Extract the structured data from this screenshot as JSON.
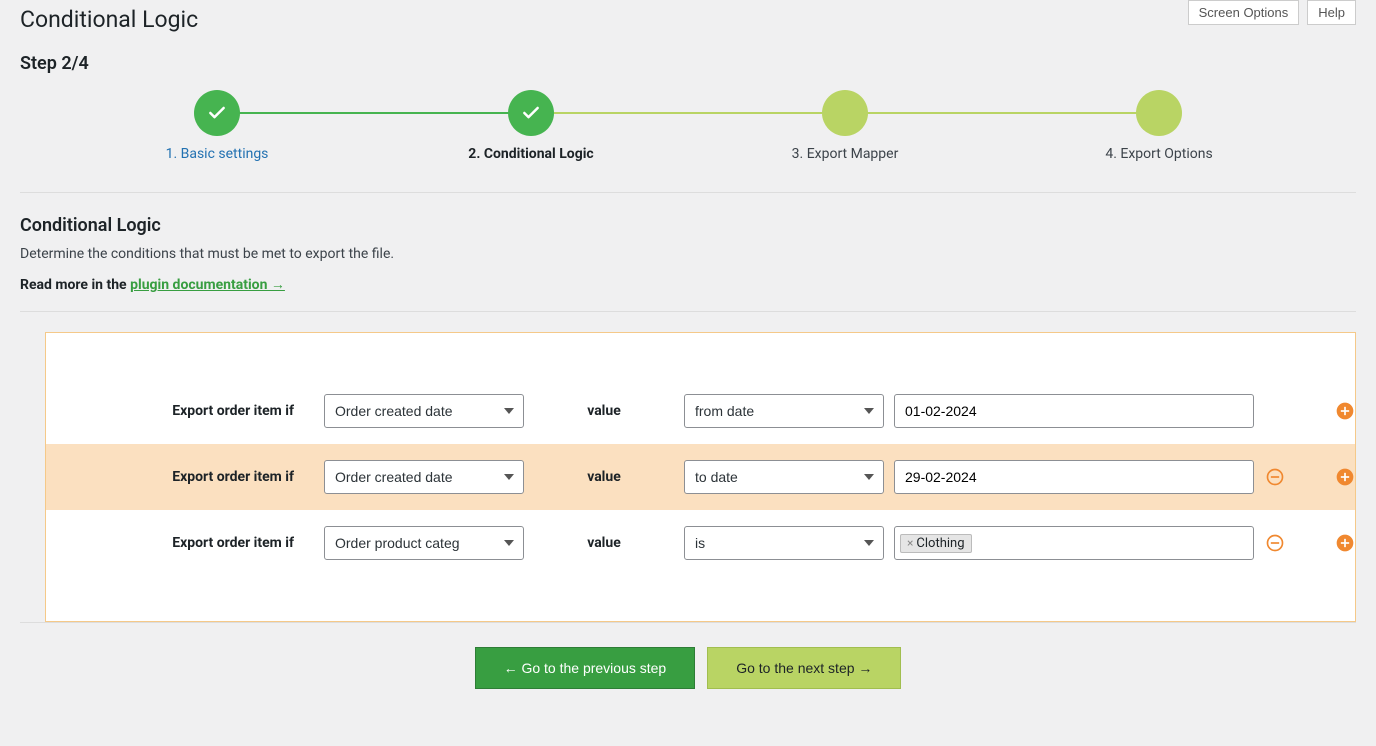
{
  "top": {
    "screen_options": "Screen Options",
    "help": "Help"
  },
  "page": {
    "title": "Conditional Logic",
    "step_heading": "Step 2/4"
  },
  "stepper": [
    {
      "label": "1. Basic settings",
      "state": "done",
      "label_style": "link"
    },
    {
      "label": "2. Conditional Logic",
      "state": "done",
      "label_style": "bold"
    },
    {
      "label": "3. Export Mapper",
      "state": "pending",
      "label_style": "plain"
    },
    {
      "label": "4. Export Options",
      "state": "pending",
      "label_style": "plain"
    }
  ],
  "section": {
    "heading": "Conditional Logic",
    "description": "Determine the conditions that must be met to export the file.",
    "read_more_prefix": "Read more in the ",
    "doc_link": "plugin documentation →"
  },
  "rules": [
    {
      "label": "Export order item if",
      "field": "Order created date",
      "value_label": "value",
      "operator": "from date",
      "value": "01-02-2024",
      "has_remove": false,
      "highlight": false,
      "tags": []
    },
    {
      "label": "Export order item if",
      "field": "Order created date",
      "value_label": "value",
      "operator": "to date",
      "value": "29-02-2024",
      "has_remove": true,
      "highlight": true,
      "tags": []
    },
    {
      "label": "Export order item if",
      "field": "Order product categ",
      "value_label": "value",
      "operator": "is",
      "value": "",
      "has_remove": true,
      "highlight": false,
      "tags": [
        "Clothing"
      ]
    }
  ],
  "nav": {
    "prev": "← Go to the previous step",
    "next": "Go to the next step →"
  }
}
